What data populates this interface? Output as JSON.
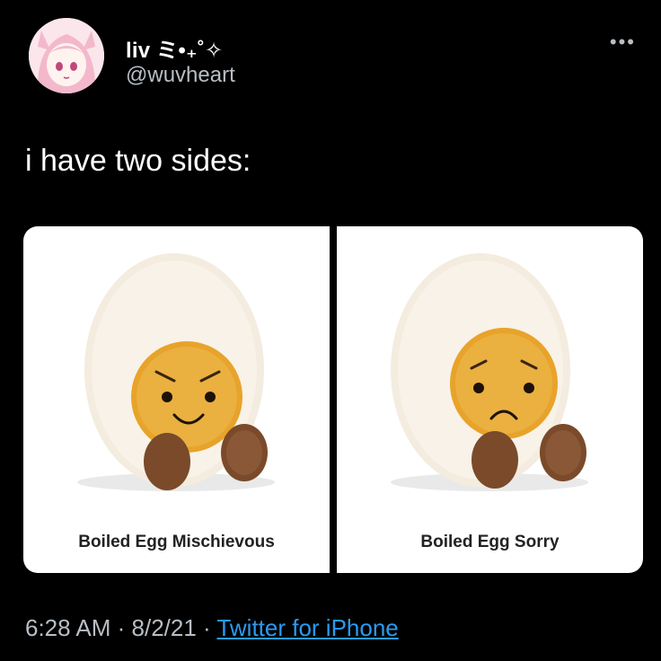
{
  "author": {
    "display_name": "liv ミ•₊˚✧",
    "handle": "@wuvheart"
  },
  "menu": {
    "more_label": "•••"
  },
  "tweet": {
    "text": "i have two sides:"
  },
  "media": [
    {
      "caption": "Boiled Egg Mischievous"
    },
    {
      "caption": "Boiled Egg Sorry"
    }
  ],
  "meta": {
    "time": "6:28 AM",
    "sep1": " · ",
    "date": "8/2/21",
    "sep2": " · ",
    "source": "Twitter for iPhone"
  },
  "colors": {
    "background": "#000000",
    "link": "#2a9bf0",
    "muted": "#b8bec4",
    "yolk": "#e8a32a",
    "feet": "#7a4a2a"
  }
}
